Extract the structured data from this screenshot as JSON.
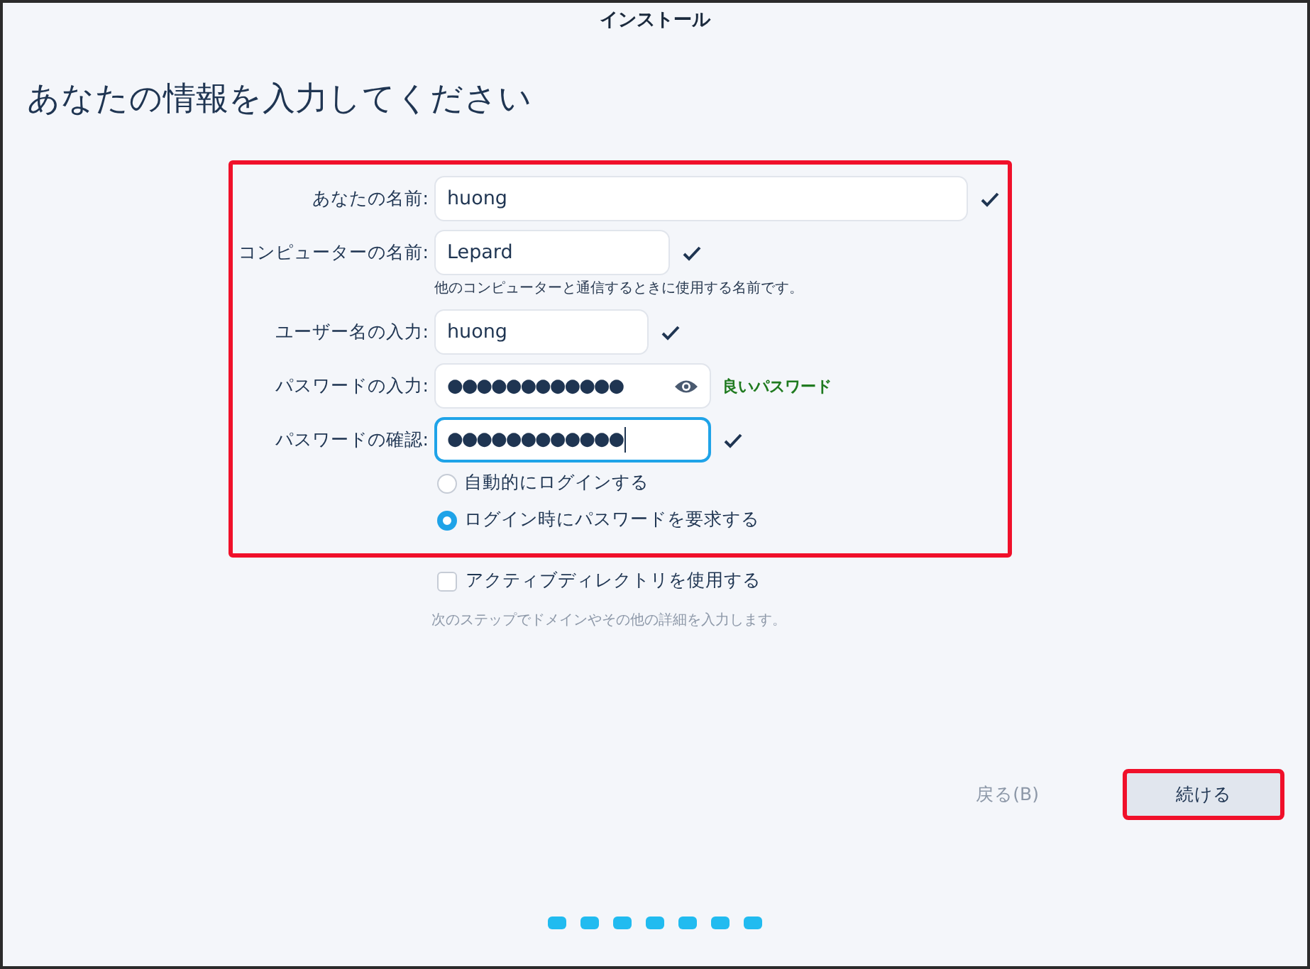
{
  "window": {
    "title": "インストール"
  },
  "heading": "あなたの情報を入力してください",
  "form": {
    "highlighted": true,
    "fields": [
      {
        "kind": "text",
        "label": "あなたの名前:",
        "value": "huong",
        "valid": true,
        "focused": false
      },
      {
        "kind": "text",
        "label": "コンピューターの名前:",
        "value": "Lepard",
        "valid": true,
        "focused": false,
        "hint": "他のコンピューターと通信するときに使用する名前です。"
      },
      {
        "kind": "text",
        "label": "ユーザー名の入力:",
        "value": "huong",
        "valid": true,
        "focused": false
      },
      {
        "kind": "password",
        "label": "パスワードの入力:",
        "value": "●●●●●●●●●●●●",
        "valid": false,
        "focused": false,
        "strength": "良いパスワード"
      },
      {
        "kind": "password",
        "label": "パスワードの確認:",
        "value": "●●●●●●●●●●●●",
        "valid": true,
        "focused": true
      }
    ],
    "login_options": [
      {
        "label": "自動的にログインする",
        "selected": false
      },
      {
        "label": "ログイン時にパスワードを要求する",
        "selected": true
      }
    ]
  },
  "active_directory": {
    "label": "アクティブディレクトリを使用する",
    "checked": false,
    "hint": "次のステップでドメインやその他の詳細を入力します。"
  },
  "buttons": [
    {
      "kind": "back",
      "label": "戻る(B)",
      "disabled": true,
      "highlighted": false
    },
    {
      "kind": "next",
      "label": "続ける",
      "disabled": false,
      "highlighted": true
    }
  ],
  "steps": [
    {
      "selected": false
    },
    {
      "selected": false
    },
    {
      "selected": false
    },
    {
      "selected": false
    },
    {
      "selected": false
    },
    {
      "selected": false
    },
    {
      "selected": false
    }
  ]
}
